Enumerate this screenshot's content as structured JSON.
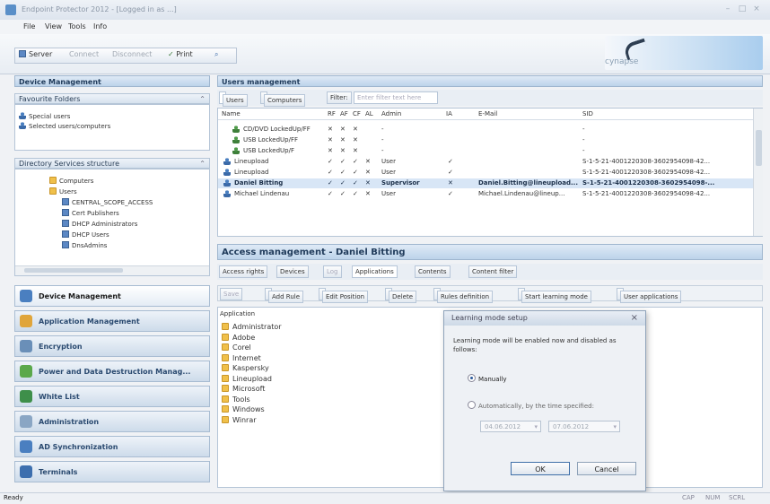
{
  "window": {
    "title": "Endpoint Protector 2012 - [Logged in as ...]",
    "close": "×",
    "minimize": "–",
    "maximize": "□"
  },
  "menu": [
    "File",
    "View",
    "Tools",
    "Info"
  ],
  "toolbar": {
    "server": "Server",
    "connect": "Connect",
    "disconnect": "Disconnect",
    "print": "Print",
    "search": ""
  },
  "logo_text": "cynapse",
  "left": {
    "device_management_title": "Device Management",
    "favorite_folders_title": "Favourite Folders",
    "favorite_items": [
      "Special users",
      "Selected users/computers"
    ],
    "directory_title": "Directory Services structure",
    "tree": [
      "Computers",
      "Users",
      "CENTRAL_SCOPE_ACCESS",
      "Cert Publishers",
      "DHCP Administrators",
      "DHCP Users",
      "DnsAdmins"
    ],
    "nav": [
      {
        "label": "Device Management",
        "active": true
      },
      {
        "label": "Application Management",
        "active": false
      },
      {
        "label": "Encryption",
        "active": false
      },
      {
        "label": "Power and Data Destruction Manag...",
        "active": false
      },
      {
        "label": "White List",
        "active": false
      },
      {
        "label": "Administration",
        "active": false
      },
      {
        "label": "AD Synchronization",
        "active": false
      },
      {
        "label": "Terminals",
        "active": false
      }
    ]
  },
  "users": {
    "title": "Users management",
    "tabs": [
      "Users",
      "Computers",
      "Filter:"
    ],
    "filter_placeholder": "Enter filter text here",
    "columns": [
      "Name",
      "RF",
      "AF",
      "CF",
      "AL",
      "Admin",
      "IA",
      "E-Mail",
      "SID"
    ],
    "rows": [
      {
        "name": "CD/DVD LockedUp/FF",
        "flags": [
          "x",
          "x",
          "x"
        ],
        "admin": "-",
        "ia": "",
        "email": "",
        "sid": "-"
      },
      {
        "name": "USB LockedUp/FF",
        "flags": [
          "x",
          "x",
          "x"
        ],
        "admin": "-",
        "ia": "",
        "email": "",
        "sid": "-"
      },
      {
        "name": "USB LockedUp/F",
        "flags": [
          "x",
          "x",
          "x"
        ],
        "admin": "-",
        "ia": "",
        "email": "",
        "sid": "-"
      },
      {
        "name": "Lineupload",
        "flags": [
          "c",
          "c",
          "c",
          "x"
        ],
        "admin": "User",
        "ia": "c",
        "email": "",
        "sid": "S-1-5-21-4001220308-3602954098-42..."
      },
      {
        "name": "Lineupload",
        "flags": [
          "c",
          "c",
          "c",
          "x"
        ],
        "admin": "User",
        "ia": "c",
        "email": "",
        "sid": "S-1-5-21-4001220308-3602954098-42..."
      },
      {
        "name": "Daniel Bitting",
        "flags": [
          "c",
          "c",
          "c",
          "x"
        ],
        "admin": "Supervisor",
        "ia": "x",
        "email": "Daniel.Bitting@lineupload...",
        "sid": "S-1-5-21-4001220308-3602954098-...",
        "selected": true
      },
      {
        "name": "Michael Lindenau",
        "flags": [
          "c",
          "c",
          "c",
          "x"
        ],
        "admin": "User",
        "ia": "c",
        "email": "Michael.Lindenau@lineup...",
        "sid": "S-1-5-21-4001220308-3602954098-42..."
      }
    ]
  },
  "access": {
    "title": "Access management - Daniel Bitting",
    "tabs": [
      "Access rights",
      "Devices",
      "Log",
      "Applications",
      "Contents",
      "Content filter"
    ],
    "toolbar": [
      "Save",
      "Add Rule",
      "Edit Position",
      "Delete",
      "Rules definition",
      "Start learning mode",
      "User applications"
    ],
    "app_header": "Application",
    "apps": [
      "Administrator",
      "Adobe",
      "Corel",
      "Internet",
      "Kaspersky",
      "Lineupload",
      "Microsoft",
      "Tools",
      "Windows",
      "Winrar"
    ]
  },
  "dialog": {
    "title": "Learning mode setup",
    "close": "×",
    "text": "Learning mode will be enabled now and disabled as follows:",
    "opt_manual": "Manually",
    "opt_auto": "Automatically, by the time specified:",
    "date_from": "04.06.2012",
    "date_to": "07.06.2012",
    "ok": "OK",
    "cancel": "Cancel"
  },
  "status": {
    "left": "Ready",
    "right": [
      "CAP",
      "NUM",
      "SCRL"
    ]
  },
  "colors": {
    "accent": "#4a7fc0",
    "deny": "#d4372a",
    "allow": "#2f9a3a",
    "header": "#bcd3ea"
  }
}
